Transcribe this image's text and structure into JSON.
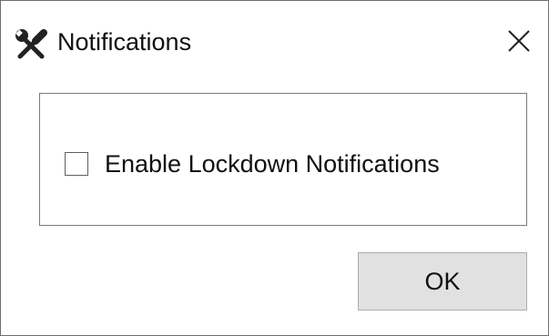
{
  "window": {
    "title": "Notifications",
    "title_icon": "wrench-screwdriver-icon",
    "close_icon": "close-icon"
  },
  "options": {
    "enable_lockdown_notifications": {
      "label": "Enable Lockdown Notifications",
      "checked": false
    }
  },
  "buttons": {
    "ok_label": "OK"
  },
  "colors": {
    "text": "#111111",
    "button_face": "#e1e1e1",
    "button_border": "#adadad",
    "group_border": "#7a7a7a"
  }
}
